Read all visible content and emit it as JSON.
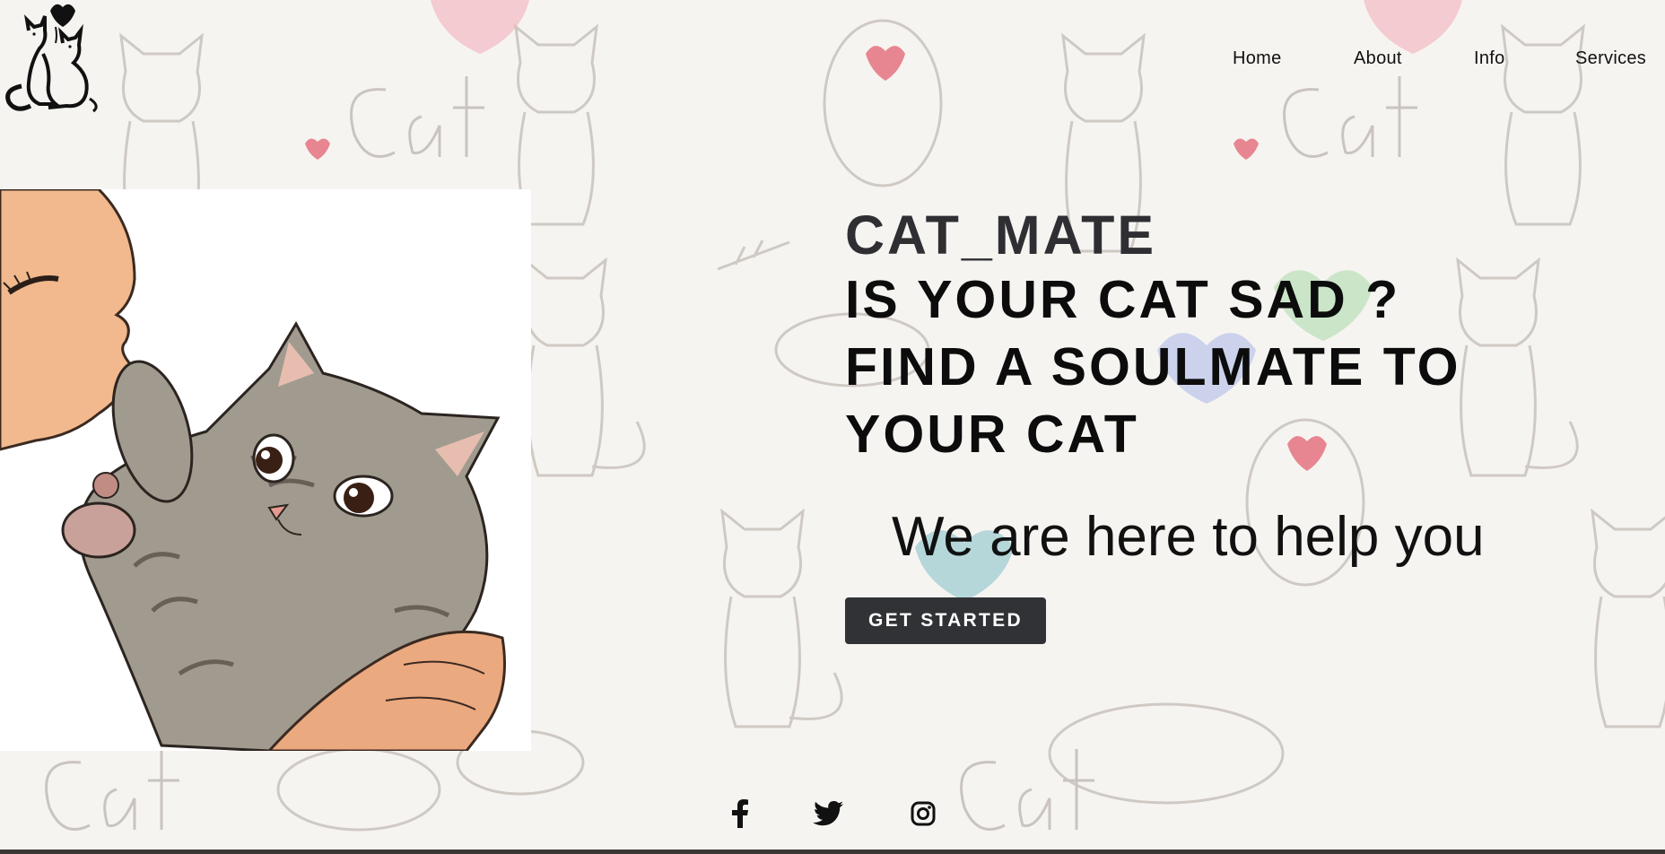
{
  "nav": {
    "items": [
      "Home",
      "About",
      "Info",
      "Services"
    ]
  },
  "hero": {
    "brand": "CAT_MATE",
    "tagline": "IS YOUR CAT SAD ? FIND A SOULMATE TO YOUR CAT",
    "subtitle": "We are here to help you",
    "cta_label": "GET STARTED"
  },
  "social": [
    "facebook-icon",
    "twitter-icon",
    "instagram-icon"
  ],
  "colors": {
    "text_dark": "#0c0c0c",
    "brand_gray": "#2f2f33",
    "button_bg": "#303236",
    "button_text": "#ffffff"
  }
}
